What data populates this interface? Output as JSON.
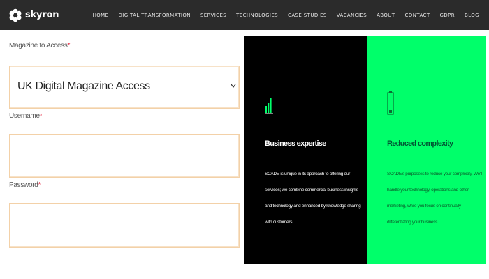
{
  "header": {
    "brand": "skyron",
    "nav": [
      "HOME",
      "DIGITAL TRANSFORMATION",
      "SERVICES",
      "TECHNOLOGIES",
      "CASE STUDIES",
      "VACANCIES",
      "ABOUT",
      "CONTACT",
      "GDPR",
      "BLOG"
    ]
  },
  "form": {
    "magazine_label": "Magazine to Access",
    "magazine_value": "UK Digital Magazine Access",
    "username_label": "Username",
    "username_value": "",
    "password_label": "Password",
    "password_value": "",
    "required_mark": "*"
  },
  "panels": [
    {
      "title": "Business expertise",
      "text": "SCADE is unique in its approach to offering our services; we combine commercial business insights and technology and enhanced by knowledge sharing with customers."
    },
    {
      "title": "Reduced complexity",
      "text": "SCADE's purpose is to reduce your complexity. We'll handle your technology, operations and other marketing, while you focus on continually differentiating your business."
    }
  ],
  "colors": {
    "header_bg": "#2b2b2b",
    "panel_black": "#000000",
    "panel_green": "#00ff6a",
    "field_border": "#f3d1a8",
    "required": "#e5203a"
  },
  "icons": {
    "logo": "flower-logo-icon",
    "select_arrow": "chevron-down-icon",
    "panel_1": "signal-bars-icon",
    "panel_2": "battery-icon"
  }
}
